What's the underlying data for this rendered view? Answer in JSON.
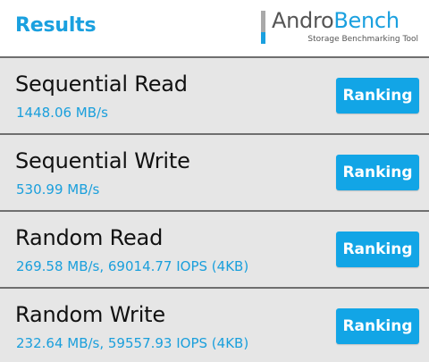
{
  "header": {
    "title": "Results",
    "logo": {
      "name_part1": "Andro",
      "name_part2": "Bench",
      "tagline": "Storage Benchmarking Tool"
    }
  },
  "results": [
    {
      "title": "Sequential Read",
      "value": "1448.06 MB/s",
      "button_label": "Ranking"
    },
    {
      "title": "Sequential Write",
      "value": "530.99 MB/s",
      "button_label": "Ranking"
    },
    {
      "title": "Random Read",
      "value": "269.58 MB/s, 69014.77 IOPS (4KB)",
      "button_label": "Ranking"
    },
    {
      "title": "Random Write",
      "value": "232.64 MB/s, 59557.93 IOPS (4KB)",
      "button_label": "Ranking"
    }
  ],
  "colors": {
    "accent": "#1aa0df",
    "button": "#12a5e6",
    "row_background": "#e6e6e6",
    "divider": "#6f6f6f"
  }
}
